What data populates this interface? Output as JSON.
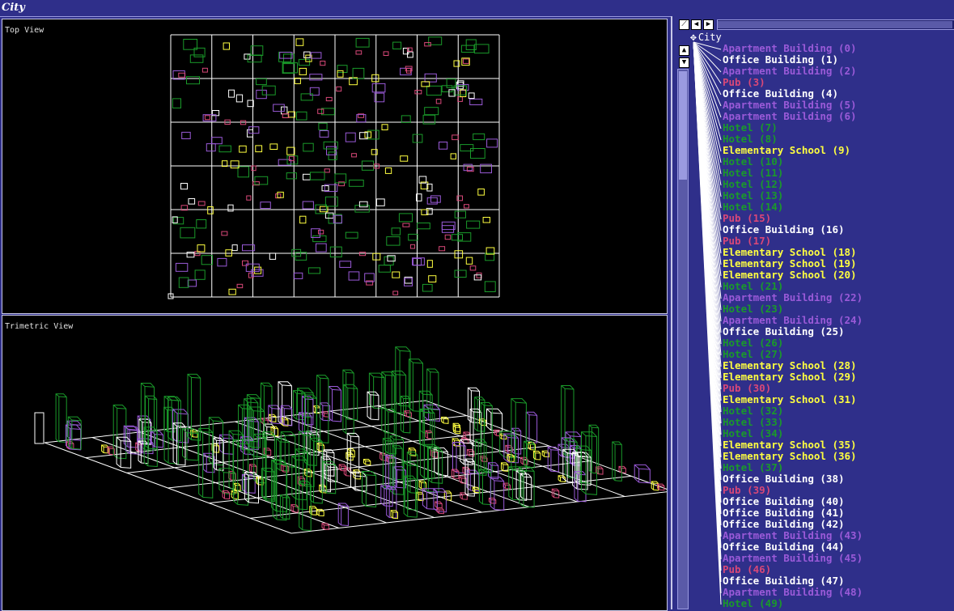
{
  "window": {
    "title": "City"
  },
  "views": {
    "top_label": "Top View",
    "trimetric_label": "Trimetric View"
  },
  "toolbar": {
    "icons": [
      "diagonal-icon",
      "arrow-left-icon",
      "arrow-right-icon",
      "move-icon",
      "arrow-up-icon",
      "arrow-down-icon"
    ]
  },
  "tree": {
    "root": "City",
    "colors": {
      "Apartment Building": "#9a5ad8",
      "Office Building": "#ffffff",
      "Pub": "#d84878",
      "Hotel": "#1a9a2a",
      "Elementary School": "#ffff40"
    },
    "items": [
      {
        "label": "Apartment Building (0)",
        "kind": "Apartment Building"
      },
      {
        "label": "Office Building (1)",
        "kind": "Office Building"
      },
      {
        "label": "Apartment Building (2)",
        "kind": "Apartment Building"
      },
      {
        "label": "Pub (3)",
        "kind": "Pub"
      },
      {
        "label": "Office Building (4)",
        "kind": "Office Building"
      },
      {
        "label": "Apartment Building (5)",
        "kind": "Apartment Building"
      },
      {
        "label": "Apartment Building (6)",
        "kind": "Apartment Building"
      },
      {
        "label": "Hotel (7)",
        "kind": "Hotel"
      },
      {
        "label": "Hotel (8)",
        "kind": "Hotel"
      },
      {
        "label": "Elementary School (9)",
        "kind": "Elementary School"
      },
      {
        "label": "Hotel (10)",
        "kind": "Hotel"
      },
      {
        "label": "Hotel (11)",
        "kind": "Hotel"
      },
      {
        "label": "Hotel (12)",
        "kind": "Hotel"
      },
      {
        "label": "Hotel (13)",
        "kind": "Hotel"
      },
      {
        "label": "Hotel (14)",
        "kind": "Hotel"
      },
      {
        "label": "Pub (15)",
        "kind": "Pub"
      },
      {
        "label": "Office Building (16)",
        "kind": "Office Building"
      },
      {
        "label": "Pub (17)",
        "kind": "Pub"
      },
      {
        "label": "Elementary School (18)",
        "kind": "Elementary School"
      },
      {
        "label": "Elementary School (19)",
        "kind": "Elementary School"
      },
      {
        "label": "Elementary School (20)",
        "kind": "Elementary School"
      },
      {
        "label": "Hotel (21)",
        "kind": "Hotel"
      },
      {
        "label": "Apartment Building (22)",
        "kind": "Apartment Building"
      },
      {
        "label": "Hotel (23)",
        "kind": "Hotel"
      },
      {
        "label": "Apartment Building (24)",
        "kind": "Apartment Building"
      },
      {
        "label": "Office Building (25)",
        "kind": "Office Building"
      },
      {
        "label": "Hotel (26)",
        "kind": "Hotel"
      },
      {
        "label": "Hotel (27)",
        "kind": "Hotel"
      },
      {
        "label": "Elementary School (28)",
        "kind": "Elementary School"
      },
      {
        "label": "Elementary School (29)",
        "kind": "Elementary School"
      },
      {
        "label": "Pub (30)",
        "kind": "Pub"
      },
      {
        "label": "Elementary School (31)",
        "kind": "Elementary School"
      },
      {
        "label": "Hotel (32)",
        "kind": "Hotel"
      },
      {
        "label": "Hotel (33)",
        "kind": "Hotel"
      },
      {
        "label": "Hotel (34)",
        "kind": "Hotel"
      },
      {
        "label": "Elementary School (35)",
        "kind": "Elementary School"
      },
      {
        "label": "Elementary School (36)",
        "kind": "Elementary School"
      },
      {
        "label": "Hotel (37)",
        "kind": "Hotel"
      },
      {
        "label": "Office Building (38)",
        "kind": "Office Building"
      },
      {
        "label": "Pub (39)",
        "kind": "Pub"
      },
      {
        "label": "Office Building (40)",
        "kind": "Office Building"
      },
      {
        "label": "Office Building (41)",
        "kind": "Office Building"
      },
      {
        "label": "Office Building (42)",
        "kind": "Office Building"
      },
      {
        "label": "Apartment Building (43)",
        "kind": "Apartment Building"
      },
      {
        "label": "Office Building (44)",
        "kind": "Office Building"
      },
      {
        "label": "Apartment Building (45)",
        "kind": "Apartment Building"
      },
      {
        "label": "Pub (46)",
        "kind": "Pub"
      },
      {
        "label": "Office Building (47)",
        "kind": "Office Building"
      },
      {
        "label": "Apartment Building (48)",
        "kind": "Apartment Building"
      },
      {
        "label": "Hotel (49)",
        "kind": "Hotel"
      }
    ]
  }
}
